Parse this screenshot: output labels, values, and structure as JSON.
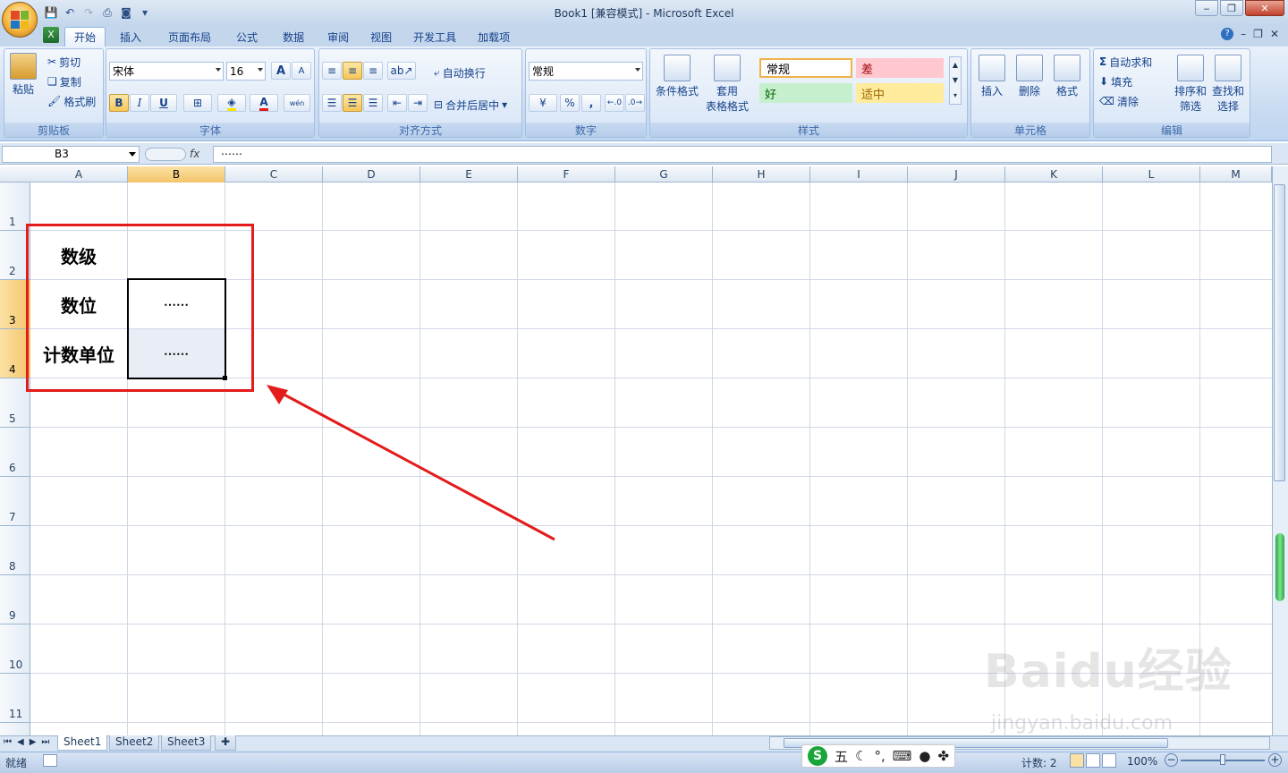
{
  "window": {
    "title": "Book1  [兼容模式] - Microsoft Excel"
  },
  "tabs": [
    "开始",
    "插入",
    "页面布局",
    "公式",
    "数据",
    "审阅",
    "视图",
    "开发工具",
    "加载项"
  ],
  "ribbon": {
    "clipboard": {
      "label": "剪贴板",
      "paste": "粘贴",
      "cut": "剪切",
      "copy": "复制",
      "format_painter": "格式刷"
    },
    "font": {
      "label": "字体",
      "name": "宋体",
      "size": "16",
      "bold": "B",
      "italic": "I",
      "underline": "U",
      "grow": "A",
      "shrink": "A",
      "color_a": "A",
      "wen": "wén"
    },
    "alignment": {
      "label": "对齐方式",
      "wrap": "自动换行",
      "merge": "合并后居中"
    },
    "number": {
      "label": "数字",
      "format": "常规",
      "percent": "%",
      "comma": ","
    },
    "styles": {
      "label": "样式",
      "conditional": "条件格式",
      "table_format_1": "套用",
      "table_format_2": "表格格式",
      "normal": "常规",
      "bad": "差",
      "good": "好",
      "neutral": "适中"
    },
    "cells": {
      "label": "单元格",
      "insert": "插入",
      "delete": "删除",
      "format": "格式"
    },
    "editing": {
      "label": "编辑",
      "autosum": "自动求和",
      "fill": "填充",
      "clear": "清除",
      "sort_1": "排序和",
      "sort_2": "筛选",
      "find_1": "查找和",
      "find_2": "选择",
      "sigma": "Σ"
    }
  },
  "formula_bar": {
    "name_box": "B3",
    "fx": "fx",
    "value": "⋯⋯"
  },
  "columns": [
    "A",
    "B",
    "C",
    "D",
    "E",
    "F",
    "G",
    "H",
    "I",
    "J",
    "K",
    "L",
    "M"
  ],
  "rows": [
    "1",
    "2",
    "3",
    "4",
    "5",
    "6",
    "7",
    "8",
    "9",
    "10",
    "11"
  ],
  "cells": {
    "A2": "数级",
    "A3": "数位",
    "A4": "计数单位",
    "B3": "⋯⋯",
    "B4": "⋯⋯"
  },
  "sheets": [
    "Sheet1",
    "Sheet2",
    "Sheet3"
  ],
  "status": {
    "ready": "就绪",
    "count": "计数: 2",
    "zoom": "100%"
  },
  "ime": {
    "mode": "五"
  },
  "watermark": {
    "text": "Baidu经验",
    "url": "jingyan.baidu.com"
  },
  "colors": {
    "annotation": "#e31b1b",
    "accent": "#15428b"
  }
}
